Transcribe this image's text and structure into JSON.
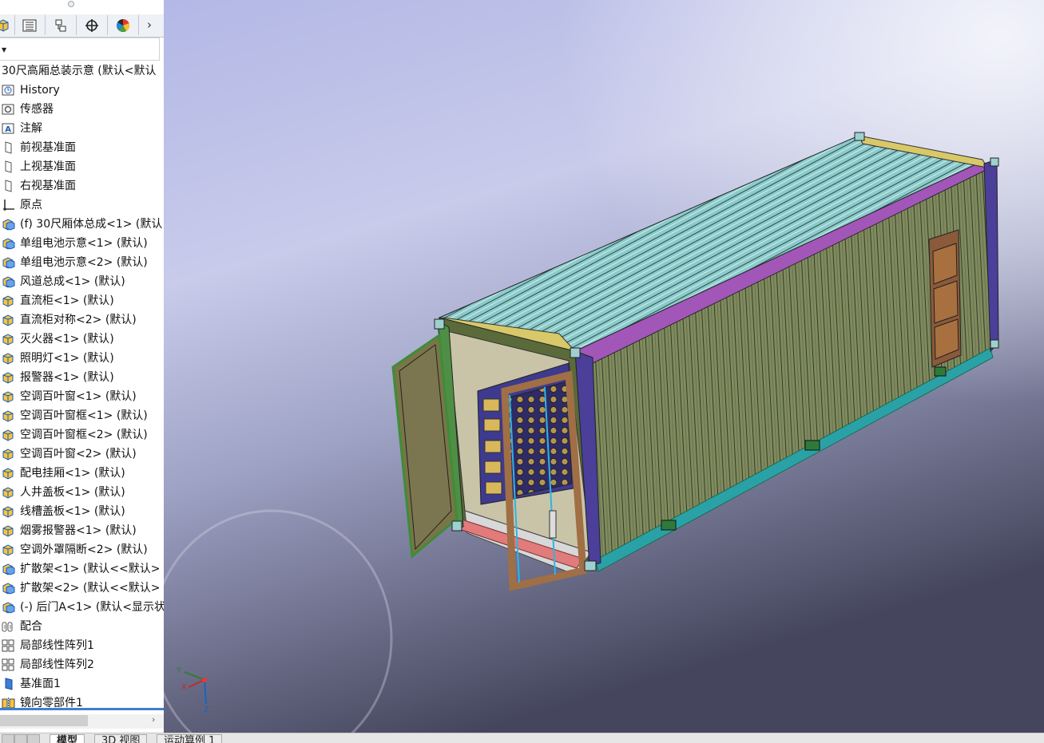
{
  "feature_tree": {
    "root_label": "30尺高厢总装示意  (默认<默认",
    "items": [
      {
        "label": "History",
        "icon": "history-icon"
      },
      {
        "label": "传感器",
        "icon": "sensor-icon"
      },
      {
        "label": "注解",
        "icon": "annotation-icon"
      },
      {
        "label": "前视基准面",
        "icon": "plane-icon"
      },
      {
        "label": "上视基准面",
        "icon": "plane-icon"
      },
      {
        "label": "右视基准面",
        "icon": "plane-icon"
      },
      {
        "label": "原点",
        "icon": "origin-icon"
      },
      {
        "label": "(f) 30尺厢体总成<1> (默认",
        "icon": "assembly-icon"
      },
      {
        "label": "单组电池示意<1> (默认)",
        "icon": "assembly-icon"
      },
      {
        "label": "单组电池示意<2> (默认)",
        "icon": "assembly-icon"
      },
      {
        "label": "风道总成<1> (默认)",
        "icon": "assembly-icon"
      },
      {
        "label": "直流柜<1> (默认)",
        "icon": "part-icon"
      },
      {
        "label": "直流柜对称<2> (默认)",
        "icon": "part-icon"
      },
      {
        "label": "灭火器<1> (默认)",
        "icon": "part-icon"
      },
      {
        "label": "照明灯<1> (默认)",
        "icon": "part-icon"
      },
      {
        "label": "报警器<1> (默认)",
        "icon": "part-icon"
      },
      {
        "label": "空调百叶窗<1> (默认)",
        "icon": "part-icon"
      },
      {
        "label": "空调百叶窗框<1> (默认)",
        "icon": "part-icon"
      },
      {
        "label": "空调百叶窗框<2> (默认)",
        "icon": "part-icon"
      },
      {
        "label": "空调百叶窗<2> (默认)",
        "icon": "part-icon"
      },
      {
        "label": "配电挂厢<1> (默认)",
        "icon": "part-icon"
      },
      {
        "label": "人井盖板<1> (默认)",
        "icon": "part-icon"
      },
      {
        "label": "线槽盖板<1> (默认)",
        "icon": "part-icon"
      },
      {
        "label": "烟雾报警器<1> (默认)",
        "icon": "part-icon"
      },
      {
        "label": "空调外罩隔断<2> (默认)",
        "icon": "part-icon"
      },
      {
        "label": "扩散架<1> (默认<<默认>",
        "icon": "assembly-icon"
      },
      {
        "label": "扩散架<2> (默认<<默认>",
        "icon": "assembly-icon"
      },
      {
        "label": "(-) 后门A<1> (默认<显示状",
        "icon": "assembly-icon"
      },
      {
        "label": "配合",
        "icon": "mate-icon"
      },
      {
        "label": "局部线性阵列1",
        "icon": "pattern-icon"
      },
      {
        "label": "局部线性阵列2",
        "icon": "pattern-icon"
      },
      {
        "label": "基准面1",
        "icon": "plane-filled-icon"
      },
      {
        "label": "镜向零部件1",
        "icon": "mirror-icon"
      }
    ]
  },
  "bottom_tabs": [
    {
      "label": "模型",
      "active": true
    },
    {
      "label": "3D 视图",
      "active": false
    },
    {
      "label": "运动算例 1",
      "active": false
    }
  ],
  "triad": {
    "x_label": "X",
    "y_label": "Y",
    "z_label": "Z"
  },
  "colors": {
    "accent_blue": "#3f7ed3",
    "viewport_top": "#b7bbe6",
    "viewport_bottom": "#4a4a62"
  }
}
